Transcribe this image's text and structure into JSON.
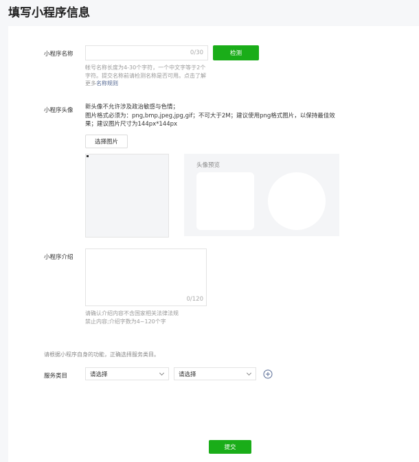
{
  "page": {
    "title": "填写小程序信息"
  },
  "name_section": {
    "label": "小程序名称",
    "input_value": "",
    "counter": "0/30",
    "check_button": "检测",
    "hint": "帐号名称长度为4-30个字符，一个中文字等于2个字符。提交名称前请检测名称是否可用。点击了解更多",
    "hint_link": "名称规则"
  },
  "avatar_section": {
    "label": "小程序头像",
    "desc_line1": "新头像不允许涉及政治敏感与色情；",
    "desc_line2": "图片格式必须为：png,bmp,jpeg,jpg,gif；不可大于2M；建议使用png格式图片，以保持最佳效果；建议图片尺寸为144px*144px",
    "choose_button": "选择图片",
    "preview_label": "头像预览"
  },
  "intro_section": {
    "label": "小程序介绍",
    "textarea_value": "",
    "counter": "0/120",
    "hint_line1": "请确认介绍内容不含国家相关法律法规",
    "hint_line2": "禁止内容;介绍字数为4~120个字"
  },
  "category_section": {
    "note": "请根据小程序自身的功能，正确选择服务类目。",
    "label": "服务类目",
    "select1": "请选择",
    "select2": "请选择"
  },
  "footer": {
    "submit_button": "提交"
  },
  "colors": {
    "accent": "#1aad19",
    "link": "#576b95"
  }
}
